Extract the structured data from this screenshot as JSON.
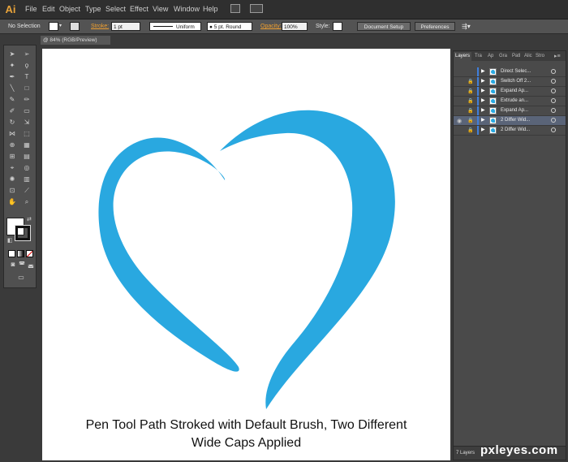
{
  "app": {
    "logo": "Ai"
  },
  "menu": [
    "File",
    "Edit",
    "Object",
    "Type",
    "Select",
    "Effect",
    "View",
    "Window",
    "Help"
  ],
  "control_bar": {
    "selection": "No Selection",
    "stroke_label": "Stroke:",
    "stroke_weight": "1 pt",
    "profile": "Uniform",
    "brush": "5 pt. Round",
    "opacity_label": "Opacity:",
    "opacity_value": "100%",
    "style_label": "Style:",
    "document_setup": "Document Setup",
    "preferences": "Preferences"
  },
  "document": {
    "tab_title": "@ 84% (RGB/Preview)"
  },
  "artwork": {
    "heart_color": "#29a8e0",
    "caption_line1": "Pen Tool Path Stroked with Default Brush, Two Different",
    "caption_line2": "Wide Caps Applied"
  },
  "layers_panel": {
    "tabs": [
      "Layers",
      "Tra",
      "Ap",
      "Gra",
      "Patl",
      "Alic",
      "Stro"
    ],
    "rows": [
      {
        "name": "Direct Selec...",
        "visible": false,
        "locked": false,
        "selected": false
      },
      {
        "name": "Switch Off 2...",
        "visible": false,
        "locked": true,
        "selected": false
      },
      {
        "name": "Expand Ap...",
        "visible": false,
        "locked": true,
        "selected": false
      },
      {
        "name": "Extrude an...",
        "visible": false,
        "locked": true,
        "selected": false
      },
      {
        "name": "Expand Ap...",
        "visible": false,
        "locked": true,
        "selected": false
      },
      {
        "name": "2 Differ Wid...",
        "visible": true,
        "locked": true,
        "selected": true
      },
      {
        "name": "2 Differ Wid...",
        "visible": false,
        "locked": true,
        "selected": false
      }
    ],
    "footer": "7 Layers"
  },
  "watermark": "pxleyes.com"
}
